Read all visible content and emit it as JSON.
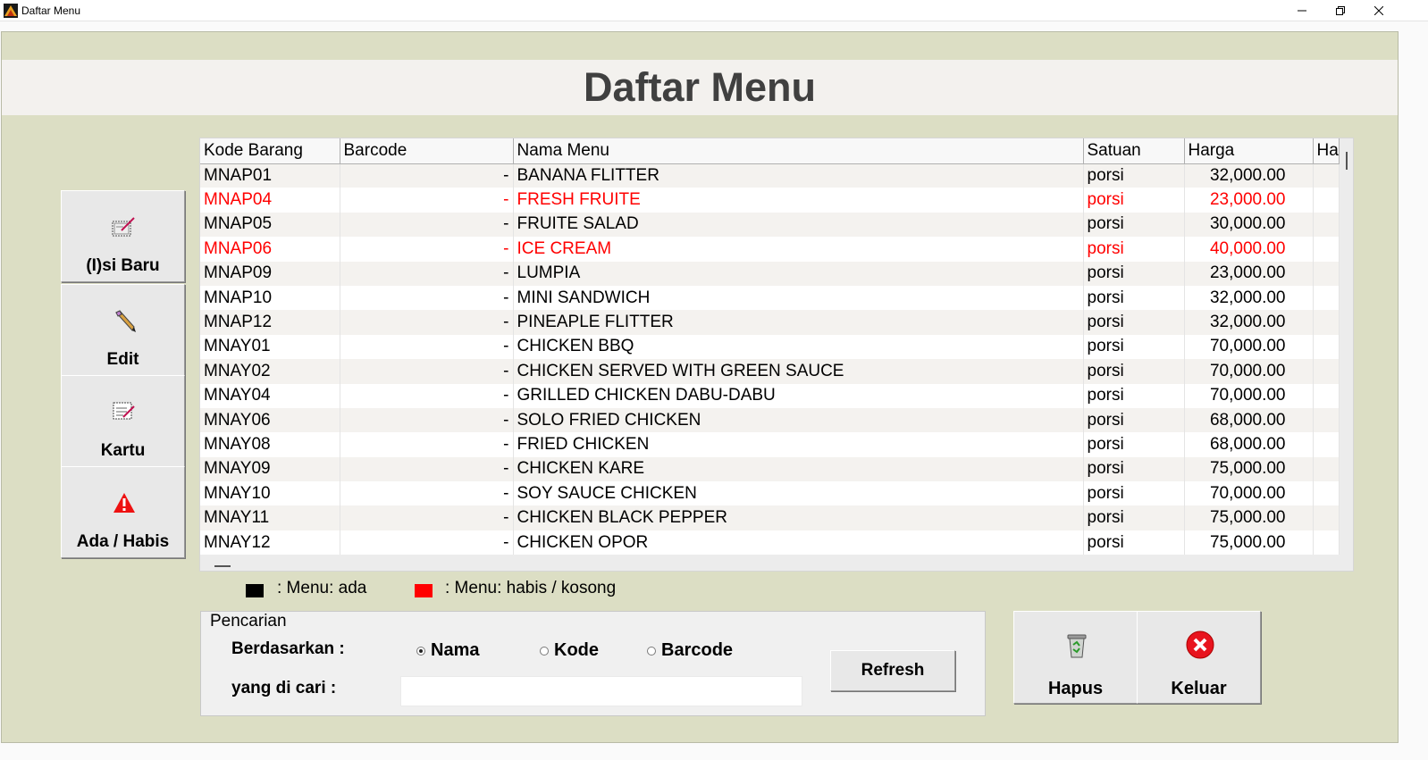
{
  "window": {
    "title": "Daftar Menu"
  },
  "header": {
    "title": "Daftar Menu"
  },
  "sidebar": {
    "buttons": [
      {
        "label": "(I)si Baru",
        "icon": "new-entry-icon"
      },
      {
        "label": "Edit",
        "icon": "pencil-icon"
      },
      {
        "label": "Kartu",
        "icon": "card-icon"
      },
      {
        "label": "Ada / Habis",
        "icon": "warning-icon"
      }
    ]
  },
  "table": {
    "columns": [
      "Kode Barang",
      "Barcode",
      "Nama Menu",
      "Satuan",
      "Harga",
      "Ha"
    ],
    "rows": [
      {
        "kode": "MNAP01",
        "barcode": "-",
        "nama": "BANANA FLITTER",
        "satuan": "porsi",
        "harga": "32,000.00",
        "habis": false
      },
      {
        "kode": "MNAP04",
        "barcode": "-",
        "nama": "FRESH FRUITE",
        "satuan": "porsi",
        "harga": "23,000.00",
        "habis": true
      },
      {
        "kode": "MNAP05",
        "barcode": "-",
        "nama": "FRUITE SALAD",
        "satuan": "porsi",
        "harga": "30,000.00",
        "habis": false
      },
      {
        "kode": "MNAP06",
        "barcode": "-",
        "nama": "ICE CREAM",
        "satuan": "porsi",
        "harga": "40,000.00",
        "habis": true
      },
      {
        "kode": "MNAP09",
        "barcode": "-",
        "nama": "LUMPIA",
        "satuan": "porsi",
        "harga": "23,000.00",
        "habis": false
      },
      {
        "kode": "MNAP10",
        "barcode": "-",
        "nama": "MINI SANDWICH",
        "satuan": "porsi",
        "harga": "32,000.00",
        "habis": false
      },
      {
        "kode": "MNAP12",
        "barcode": "-",
        "nama": "PINEAPLE FLITTER",
        "satuan": "porsi",
        "harga": "32,000.00",
        "habis": false
      },
      {
        "kode": "MNAY01",
        "barcode": "-",
        "nama": "CHICKEN BBQ",
        "satuan": "porsi",
        "harga": "70,000.00",
        "habis": false
      },
      {
        "kode": "MNAY02",
        "barcode": "-",
        "nama": "CHICKEN SERVED WITH GREEN SAUCE",
        "satuan": "porsi",
        "harga": "70,000.00",
        "habis": false
      },
      {
        "kode": "MNAY04",
        "barcode": "-",
        "nama": "GRILLED CHICKEN DABU-DABU",
        "satuan": "porsi",
        "harga": "70,000.00",
        "habis": false
      },
      {
        "kode": "MNAY06",
        "barcode": "-",
        "nama": "SOLO FRIED CHICKEN",
        "satuan": "porsi",
        "harga": "68,000.00",
        "habis": false
      },
      {
        "kode": "MNAY08",
        "barcode": "-",
        "nama": "FRIED CHICKEN",
        "satuan": "porsi",
        "harga": "68,000.00",
        "habis": false
      },
      {
        "kode": "MNAY09",
        "barcode": "-",
        "nama": "CHICKEN KARE",
        "satuan": "porsi",
        "harga": "75,000.00",
        "habis": false
      },
      {
        "kode": "MNAY10",
        "barcode": "-",
        "nama": "SOY SAUCE CHICKEN",
        "satuan": "porsi",
        "harga": "70,000.00",
        "habis": false
      },
      {
        "kode": "MNAY11",
        "barcode": "-",
        "nama": "CHICKEN BLACK PEPPER",
        "satuan": "porsi",
        "harga": "75,000.00",
        "habis": false
      },
      {
        "kode": "MNAY12",
        "barcode": "-",
        "nama": "CHICKEN OPOR",
        "satuan": "porsi",
        "harga": "75,000.00",
        "habis": false
      }
    ]
  },
  "legend": {
    "ada": {
      "label": ": Menu: ada",
      "color": "#000000"
    },
    "habis": {
      "label": ": Menu: habis / kosong",
      "color": "#ff0000"
    }
  },
  "search": {
    "group_title": "Pencarian",
    "by_label": "Berdasarkan :",
    "options": [
      {
        "label": "Nama",
        "selected": true
      },
      {
        "label": "Kode",
        "selected": false
      },
      {
        "label": "Barcode",
        "selected": false
      }
    ],
    "query_label": "yang di cari  :",
    "query_value": "",
    "refresh_label": "Refresh"
  },
  "actions": {
    "hapus": {
      "label": "Hapus",
      "icon": "recycle-bin-icon"
    },
    "keluar": {
      "label": "Keluar",
      "icon": "close-circle-icon"
    }
  },
  "colors": {
    "window_bg": "#dcdec4",
    "header_bg": "#f3f1ee",
    "habis_text": "#ff0000"
  }
}
